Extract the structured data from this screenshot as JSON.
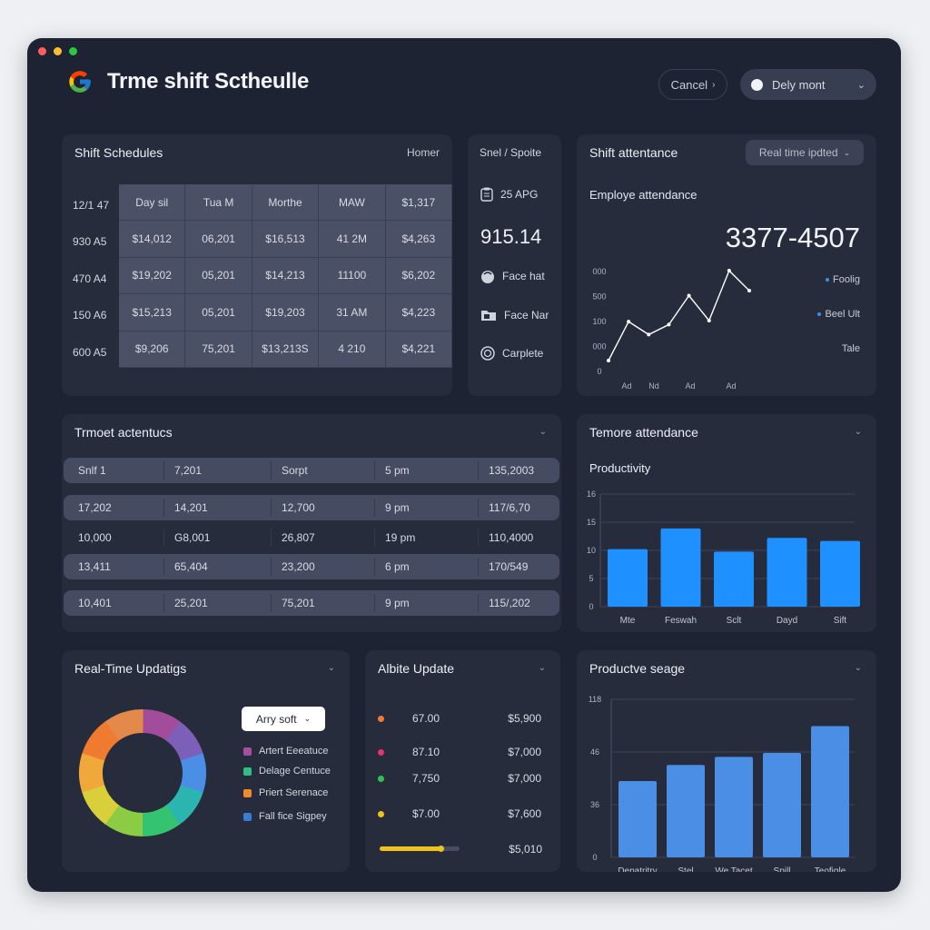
{
  "app": {
    "title": "Trme shift Sctheulle"
  },
  "header": {
    "cancel_label": "Cancel",
    "mode_label": "Dely mont",
    "colors": {
      "window_dots": [
        "#ff5f57",
        "#febc2e",
        "#28c840"
      ]
    }
  },
  "schedules": {
    "title": "Shift Schedules",
    "link": "Homer",
    "row_labels": [
      "12/1 47",
      "930 A5",
      "470 A4",
      "150 A6",
      "600 A5"
    ],
    "cells": [
      [
        "Day sil",
        "Tua M",
        "Morthe",
        "MAW",
        "$1,317"
      ],
      [
        "$14,012",
        "06,201",
        "$16,513",
        "41 2M",
        "$4,263"
      ],
      [
        "$19,202",
        "05,201",
        "$14,213",
        "11100",
        "$6,202"
      ],
      [
        "$15,213",
        "05,201",
        "$19,203",
        "31 AM",
        "$4,223"
      ],
      [
        "$9,206",
        "75,201",
        "$13,213S",
        "4 210",
        "$4,221"
      ]
    ]
  },
  "side_panel": {
    "title": "Snel / Spoite",
    "row1": "25 APG",
    "big_value": "915.14",
    "items": [
      {
        "label": "Face hat",
        "icon": "face-icon"
      },
      {
        "label": "Face Nar",
        "icon": "folder-icon"
      },
      {
        "label": "Carplete",
        "icon": "check-circle-icon"
      }
    ]
  },
  "attendance": {
    "title": "Shift attentance",
    "badge": "Real time ipdted",
    "subtitle": "Employe attendance",
    "big_value": "3377-4507",
    "legend": [
      "Foolig",
      "Beel Ult"
    ],
    "legend_extra": "Tale",
    "chart_data": {
      "type": "line",
      "y_ticks": [
        "000",
        "500",
        "100",
        "000",
        "0"
      ],
      "x_ticks": [
        "Ad",
        "Nd",
        "Ad",
        "Ad"
      ],
      "values": [
        0.1,
        0.49,
        0.36,
        0.46,
        0.75,
        0.5,
        1.0,
        0.8
      ],
      "ylim": [
        0,
        1
      ]
    }
  },
  "attendance_table": {
    "title": "Trmoet actentucs",
    "rows": [
      [
        "Snlf 1",
        "7,201",
        "Sorpt",
        "5 pm",
        "135,2003"
      ],
      [
        "17,202",
        "14,201",
        "12,700",
        "9 pm",
        "117/6,70"
      ],
      [
        "10,000",
        "G8,001",
        "26,807",
        "19 pm",
        "110,4000"
      ],
      [
        "13,411",
        "65,404",
        "23,200",
        "6 pm",
        "170/549"
      ],
      [
        "10,401",
        "25,201",
        "75,201",
        "9 pm",
        "115/,202"
      ]
    ]
  },
  "productivity": {
    "title": "Temore attendance",
    "subtitle": "Productivity",
    "chart_data": {
      "type": "bar",
      "y_ticks": [
        "16",
        "15",
        "10",
        "5",
        "0"
      ],
      "categories": [
        "Mte",
        "Feswah",
        "Sclt",
        "Dayd",
        "Sift"
      ],
      "values": [
        9.2,
        12.5,
        8.8,
        11,
        10.5
      ],
      "ylim": [
        0,
        18
      ],
      "color": "#1e90ff"
    }
  },
  "realtime": {
    "title": "Real-Time Updatigs",
    "sort_label": "Arry soft",
    "legend": [
      {
        "label": "Artert Eeeatuce",
        "color": "#a4509e"
      },
      {
        "label": "Delage Centuce",
        "color": "#2fbf86"
      },
      {
        "label": "Priert Serenace",
        "color": "#f08a2b"
      },
      {
        "label": "Fall fice Sigpey",
        "color": "#3a7bd5"
      }
    ],
    "donut_colors": [
      "#a24c9c",
      "#7b5fb8",
      "#4b8ee6",
      "#2bb5b0",
      "#34c46f",
      "#8ccc44",
      "#d9cf3a",
      "#f0a83a",
      "#f07a30",
      "#e3894a"
    ]
  },
  "updates": {
    "title": "Albite Update",
    "rows": [
      {
        "left": "67.00",
        "right": "$5,900",
        "color": "#f27a3a"
      },
      {
        "left": "87.10",
        "right": "$7,000",
        "color": "#e8336e"
      },
      {
        "left": "7,750",
        "right": "$7,000",
        "color": "#2fc052"
      },
      {
        "left": "$7.00",
        "right": "$7,600",
        "color": "#f1c21b"
      }
    ],
    "progress_value": "$5,010",
    "progress_percent": 0.76
  },
  "usage": {
    "title": "Productve seage",
    "chart_data": {
      "type": "bar",
      "y_ticks": [
        "118",
        "46",
        "36",
        "0"
      ],
      "categories": [
        "Depatritry",
        "Stel",
        "We Tacet",
        "Spill",
        "Teofigle"
      ],
      "values": [
        57,
        69,
        75,
        78,
        98
      ],
      "ylim": [
        0,
        118
      ],
      "color": "#4a8ee6"
    }
  }
}
